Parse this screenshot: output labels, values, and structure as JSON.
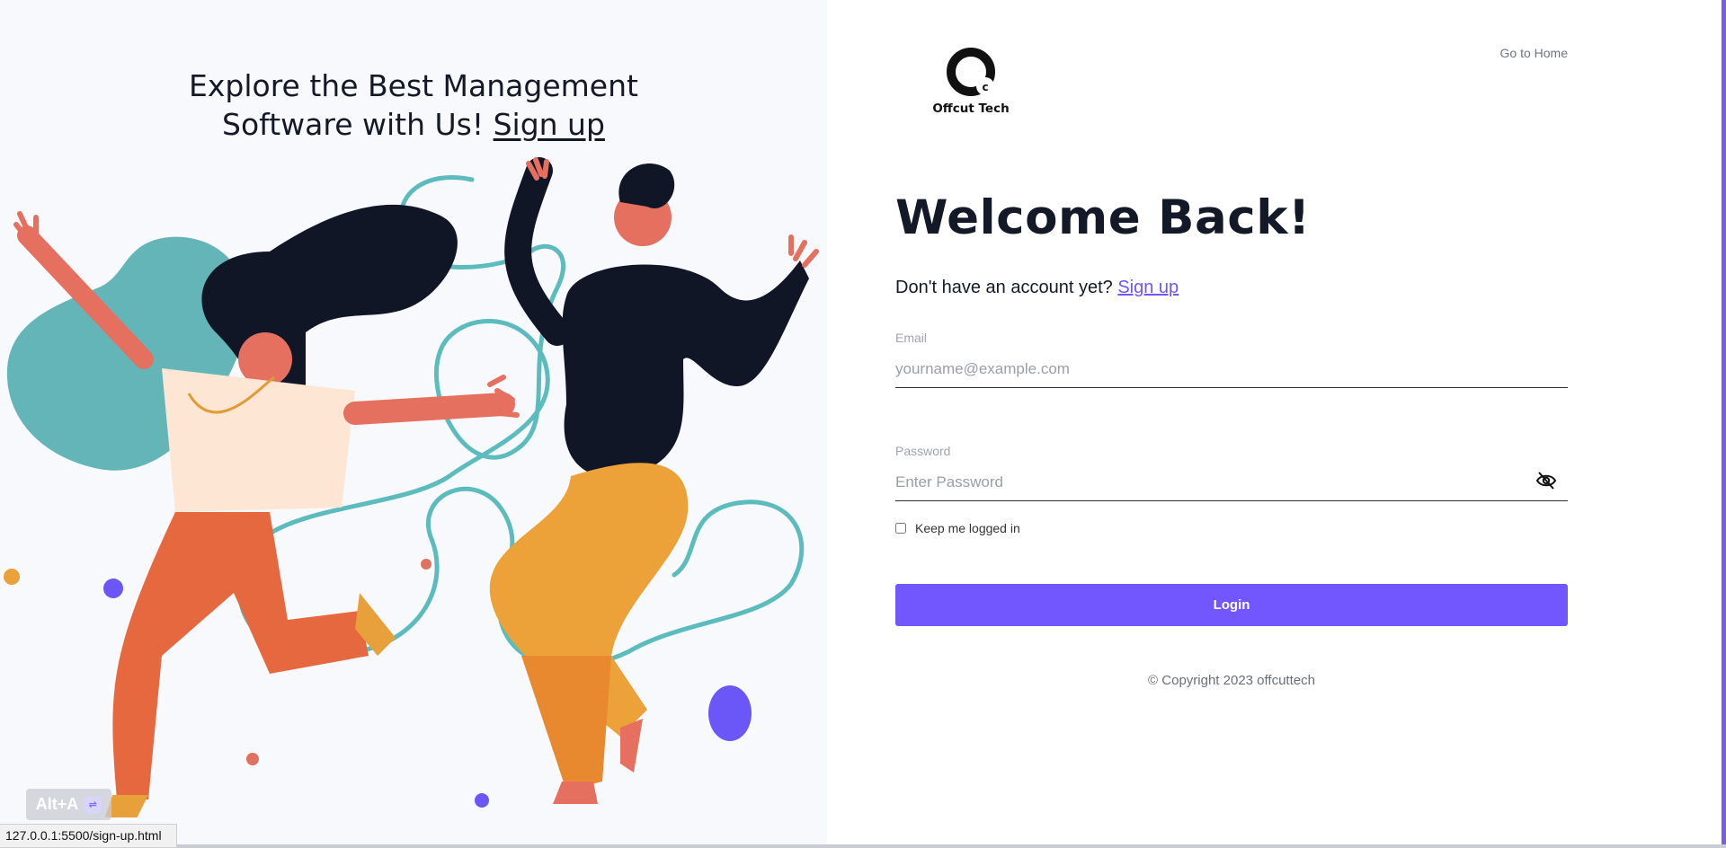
{
  "hero": {
    "title_line1": "Explore the Best Management",
    "title_line2": "Software with Us!",
    "signup_link": "Sign up"
  },
  "header": {
    "brand": "Offcut Tech",
    "logo_letter": "c",
    "go_home": "Go to Home"
  },
  "form": {
    "heading": "Welcome Back!",
    "no_account_text": "Don't have an account yet?",
    "signup_link": "Sign up",
    "email_label": "Email",
    "email_placeholder": "yourname@example.com",
    "password_label": "Password",
    "password_placeholder": "Enter Password",
    "keep_logged_in": "Keep me logged in",
    "login_button": "Login"
  },
  "footer": {
    "copyright": "© Copyright 2023 offcuttech"
  },
  "browser": {
    "status_url": "127.0.0.1:5500/sign-up.html",
    "shortcut_label": "Alt+A"
  },
  "colors": {
    "accent": "#7257ff",
    "heading": "#141928",
    "hero_bg": "#f7f9fc"
  }
}
